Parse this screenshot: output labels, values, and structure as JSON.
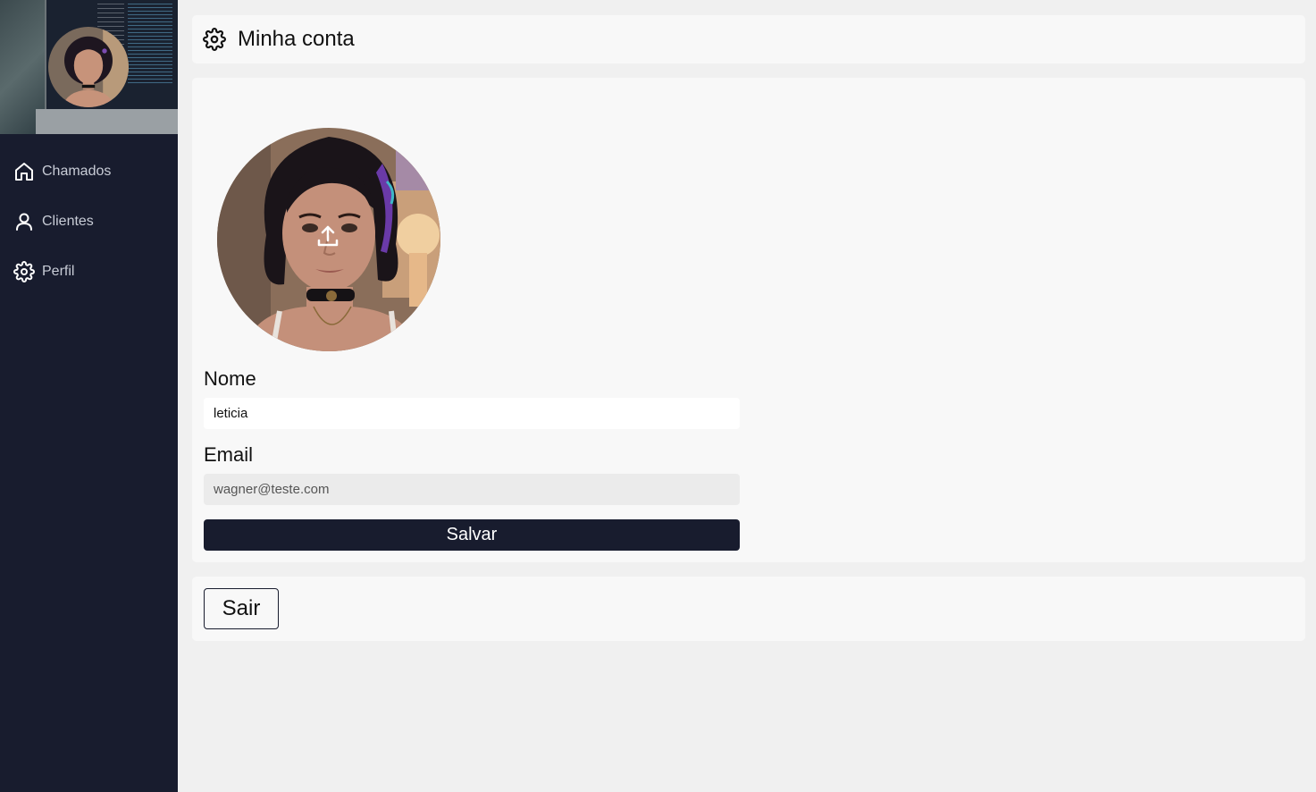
{
  "sidebar": {
    "items": [
      {
        "label": "Chamados",
        "icon": "home-icon"
      },
      {
        "label": "Clientes",
        "icon": "user-icon"
      },
      {
        "label": "Perfil",
        "icon": "gear-icon"
      }
    ]
  },
  "header": {
    "title": "Minha conta",
    "icon": "gear-icon"
  },
  "form": {
    "name_label": "Nome",
    "name_value": "leticia",
    "email_label": "Email",
    "email_value": "wagner@teste.com",
    "save_label": "Salvar",
    "upload_icon": "upload-icon"
  },
  "logout": {
    "label": "Sair"
  },
  "colors": {
    "sidebar_bg": "#181c2e",
    "page_bg": "#f0f0f0",
    "card_bg": "#f8f8f8",
    "primary_button": "#181c2e"
  }
}
